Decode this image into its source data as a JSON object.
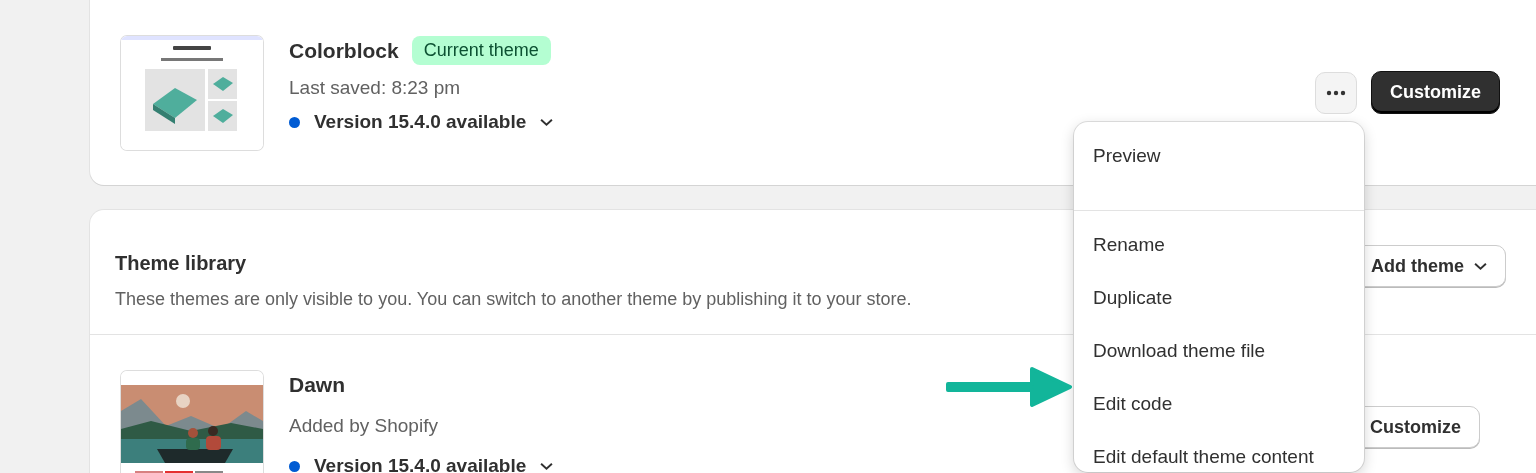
{
  "current_theme": {
    "name": "Colorblock",
    "badge": "Current theme",
    "last_saved": "Last saved: 8:23 pm",
    "version": "Version 15.4.0 available",
    "customize": "Customize"
  },
  "library": {
    "title": "Theme library",
    "description": "These themes are only visible to you. You can switch to another theme by publishing it to your store.",
    "add_button": "Add theme",
    "themes": [
      {
        "name": "Dawn",
        "subtitle": "Added by Shopify",
        "version": "Version 15.4.0 available",
        "customize": "Customize"
      }
    ]
  },
  "menu": {
    "groups": [
      [
        "Preview"
      ],
      [
        "Rename",
        "Duplicate",
        "Download theme file",
        "Edit code",
        "Edit default theme content"
      ]
    ]
  }
}
